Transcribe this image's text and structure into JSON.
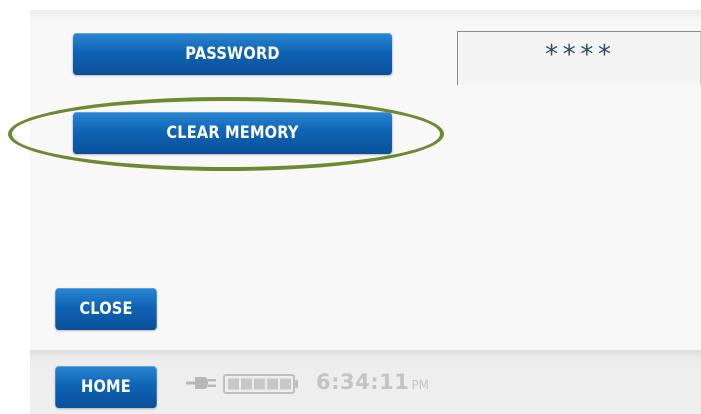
{
  "buttons": {
    "password_label": "PASSWORD",
    "clear_memory_label": "CLEAR MEMORY",
    "close_label": "CLOSE",
    "home_label": "HOME"
  },
  "password_field": {
    "value": "****"
  },
  "status_bar": {
    "time": "6:34:11",
    "ampm": "PM",
    "power_icon": "plug-icon",
    "battery_icon": "battery-icon"
  },
  "colors": {
    "button_blue": "#0f64b5",
    "highlight_oval": "#6d8a32",
    "clock_gray": "#c4c4c4"
  }
}
